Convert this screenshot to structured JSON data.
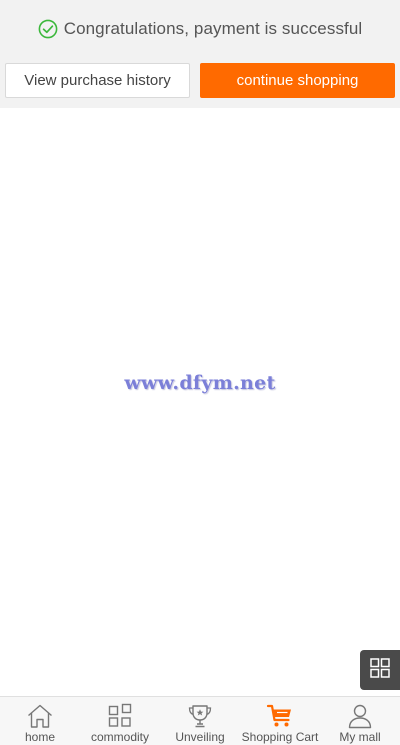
{
  "success": {
    "message": "Congratulations, payment is successful",
    "icon": "check-circle-icon",
    "icon_color": "#3cb83c"
  },
  "actions": {
    "history_label": "View purchase history",
    "continue_label": "continue shopping",
    "accent_color": "#ff6a00"
  },
  "watermark": {
    "text": "www.dfym.net"
  },
  "float_button": {
    "icon": "grid-menu-icon"
  },
  "tabbar": {
    "items": [
      {
        "label": "home",
        "icon": "home-icon"
      },
      {
        "label": "commodity",
        "icon": "category-grid-icon"
      },
      {
        "label": "Unveiling",
        "icon": "trophy-icon"
      },
      {
        "label": "Shopping Cart",
        "icon": "shopping-cart-icon",
        "active": true
      },
      {
        "label": "My mall",
        "icon": "user-icon"
      }
    ]
  }
}
